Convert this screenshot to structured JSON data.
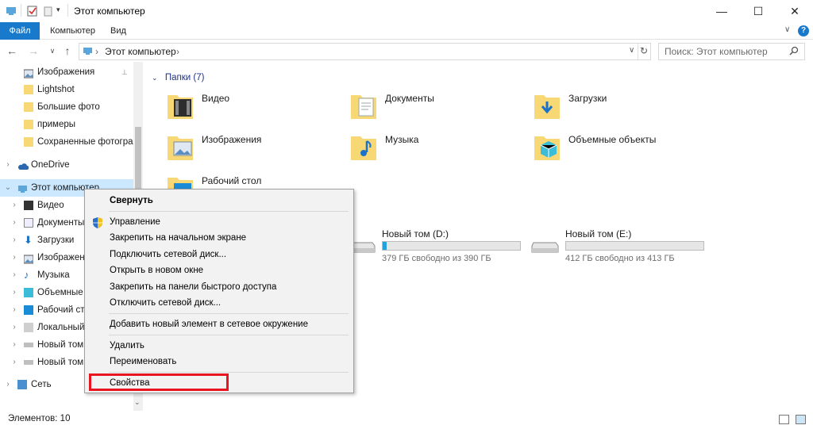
{
  "window": {
    "title": "Этот компьютер",
    "minimize": "—",
    "maximize": "☐",
    "close": "✕"
  },
  "ribbon": {
    "tabs": [
      "Файл",
      "Компьютер",
      "Вид"
    ],
    "expand": "∨",
    "help": "?"
  },
  "address": {
    "back": "←",
    "forward": "→",
    "recent": "∨",
    "up": "↑",
    "path_sep": "›",
    "path": "Этот компьютер",
    "path_tail": "›",
    "dropdown": "∨",
    "refresh": "↻"
  },
  "search": {
    "placeholder": "Поиск: Этот компьютер",
    "icon": "search-icon"
  },
  "nav": {
    "quick": [
      {
        "label": "Изображения",
        "pin": "📌"
      },
      {
        "label": "Lightshot"
      },
      {
        "label": "Большие фото"
      },
      {
        "label": "примеры"
      },
      {
        "label": "Сохраненные фотограф"
      }
    ],
    "onedrive": "OneDrive",
    "this_pc": "Этот компьютер",
    "pc_children": [
      "Видео",
      "Документы",
      "Загрузки",
      "Изображен",
      "Музыка",
      "Объемные",
      "Рабочий сто",
      "Локальный",
      "Новый том",
      "Новый том"
    ],
    "network": "Сеть"
  },
  "content": {
    "folders_header": "Папки (7)",
    "folders": [
      "Видео",
      "Документы",
      "Загрузки",
      "Изображения",
      "Музыка",
      "Объемные объекты",
      "Рабочий стол"
    ],
    "drives": [
      {
        "name": "Новый том (D:)",
        "free": "379 ГБ свободно из 390 ГБ",
        "used_fraction": 0.03
      },
      {
        "name": "Новый том (E:)",
        "free": "412 ГБ свободно из 413 ГБ",
        "used_fraction": 0.0
      }
    ]
  },
  "status": {
    "count": "Элементов: 10"
  },
  "context_menu": {
    "items": [
      "Свернуть",
      "Управление",
      "Закрепить на начальном экране",
      "Подключить сетевой диск...",
      "Открыть в новом окне",
      "Закрепить на панели быстрого доступа",
      "Отключить сетевой диск...",
      "Добавить новый элемент в сетевое окружение",
      "Удалить",
      "Переименовать",
      "Свойства"
    ]
  },
  "colors": {
    "accent": "#1979ca",
    "highlight_border": "#e8141f",
    "drive_fill": "#26a0da",
    "folder_yellow": "#f8d775"
  }
}
